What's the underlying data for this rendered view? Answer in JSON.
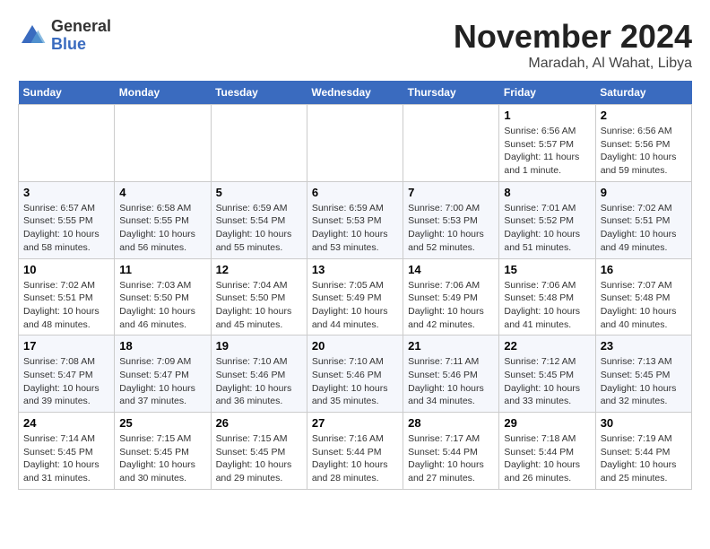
{
  "header": {
    "logo": {
      "general": "General",
      "blue": "Blue"
    },
    "title": "November 2024",
    "subtitle": "Maradah, Al Wahat, Libya"
  },
  "weekdays": [
    "Sunday",
    "Monday",
    "Tuesday",
    "Wednesday",
    "Thursday",
    "Friday",
    "Saturday"
  ],
  "weeks": [
    [
      {
        "day": "",
        "info": ""
      },
      {
        "day": "",
        "info": ""
      },
      {
        "day": "",
        "info": ""
      },
      {
        "day": "",
        "info": ""
      },
      {
        "day": "",
        "info": ""
      },
      {
        "day": "1",
        "info": "Sunrise: 6:56 AM\nSunset: 5:57 PM\nDaylight: 11 hours\nand 1 minute."
      },
      {
        "day": "2",
        "info": "Sunrise: 6:56 AM\nSunset: 5:56 PM\nDaylight: 10 hours\nand 59 minutes."
      }
    ],
    [
      {
        "day": "3",
        "info": "Sunrise: 6:57 AM\nSunset: 5:55 PM\nDaylight: 10 hours\nand 58 minutes."
      },
      {
        "day": "4",
        "info": "Sunrise: 6:58 AM\nSunset: 5:55 PM\nDaylight: 10 hours\nand 56 minutes."
      },
      {
        "day": "5",
        "info": "Sunrise: 6:59 AM\nSunset: 5:54 PM\nDaylight: 10 hours\nand 55 minutes."
      },
      {
        "day": "6",
        "info": "Sunrise: 6:59 AM\nSunset: 5:53 PM\nDaylight: 10 hours\nand 53 minutes."
      },
      {
        "day": "7",
        "info": "Sunrise: 7:00 AM\nSunset: 5:53 PM\nDaylight: 10 hours\nand 52 minutes."
      },
      {
        "day": "8",
        "info": "Sunrise: 7:01 AM\nSunset: 5:52 PM\nDaylight: 10 hours\nand 51 minutes."
      },
      {
        "day": "9",
        "info": "Sunrise: 7:02 AM\nSunset: 5:51 PM\nDaylight: 10 hours\nand 49 minutes."
      }
    ],
    [
      {
        "day": "10",
        "info": "Sunrise: 7:02 AM\nSunset: 5:51 PM\nDaylight: 10 hours\nand 48 minutes."
      },
      {
        "day": "11",
        "info": "Sunrise: 7:03 AM\nSunset: 5:50 PM\nDaylight: 10 hours\nand 46 minutes."
      },
      {
        "day": "12",
        "info": "Sunrise: 7:04 AM\nSunset: 5:50 PM\nDaylight: 10 hours\nand 45 minutes."
      },
      {
        "day": "13",
        "info": "Sunrise: 7:05 AM\nSunset: 5:49 PM\nDaylight: 10 hours\nand 44 minutes."
      },
      {
        "day": "14",
        "info": "Sunrise: 7:06 AM\nSunset: 5:49 PM\nDaylight: 10 hours\nand 42 minutes."
      },
      {
        "day": "15",
        "info": "Sunrise: 7:06 AM\nSunset: 5:48 PM\nDaylight: 10 hours\nand 41 minutes."
      },
      {
        "day": "16",
        "info": "Sunrise: 7:07 AM\nSunset: 5:48 PM\nDaylight: 10 hours\nand 40 minutes."
      }
    ],
    [
      {
        "day": "17",
        "info": "Sunrise: 7:08 AM\nSunset: 5:47 PM\nDaylight: 10 hours\nand 39 minutes."
      },
      {
        "day": "18",
        "info": "Sunrise: 7:09 AM\nSunset: 5:47 PM\nDaylight: 10 hours\nand 37 minutes."
      },
      {
        "day": "19",
        "info": "Sunrise: 7:10 AM\nSunset: 5:46 PM\nDaylight: 10 hours\nand 36 minutes."
      },
      {
        "day": "20",
        "info": "Sunrise: 7:10 AM\nSunset: 5:46 PM\nDaylight: 10 hours\nand 35 minutes."
      },
      {
        "day": "21",
        "info": "Sunrise: 7:11 AM\nSunset: 5:46 PM\nDaylight: 10 hours\nand 34 minutes."
      },
      {
        "day": "22",
        "info": "Sunrise: 7:12 AM\nSunset: 5:45 PM\nDaylight: 10 hours\nand 33 minutes."
      },
      {
        "day": "23",
        "info": "Sunrise: 7:13 AM\nSunset: 5:45 PM\nDaylight: 10 hours\nand 32 minutes."
      }
    ],
    [
      {
        "day": "24",
        "info": "Sunrise: 7:14 AM\nSunset: 5:45 PM\nDaylight: 10 hours\nand 31 minutes."
      },
      {
        "day": "25",
        "info": "Sunrise: 7:15 AM\nSunset: 5:45 PM\nDaylight: 10 hours\nand 30 minutes."
      },
      {
        "day": "26",
        "info": "Sunrise: 7:15 AM\nSunset: 5:45 PM\nDaylight: 10 hours\nand 29 minutes."
      },
      {
        "day": "27",
        "info": "Sunrise: 7:16 AM\nSunset: 5:44 PM\nDaylight: 10 hours\nand 28 minutes."
      },
      {
        "day": "28",
        "info": "Sunrise: 7:17 AM\nSunset: 5:44 PM\nDaylight: 10 hours\nand 27 minutes."
      },
      {
        "day": "29",
        "info": "Sunrise: 7:18 AM\nSunset: 5:44 PM\nDaylight: 10 hours\nand 26 minutes."
      },
      {
        "day": "30",
        "info": "Sunrise: 7:19 AM\nSunset: 5:44 PM\nDaylight: 10 hours\nand 25 minutes."
      }
    ]
  ]
}
